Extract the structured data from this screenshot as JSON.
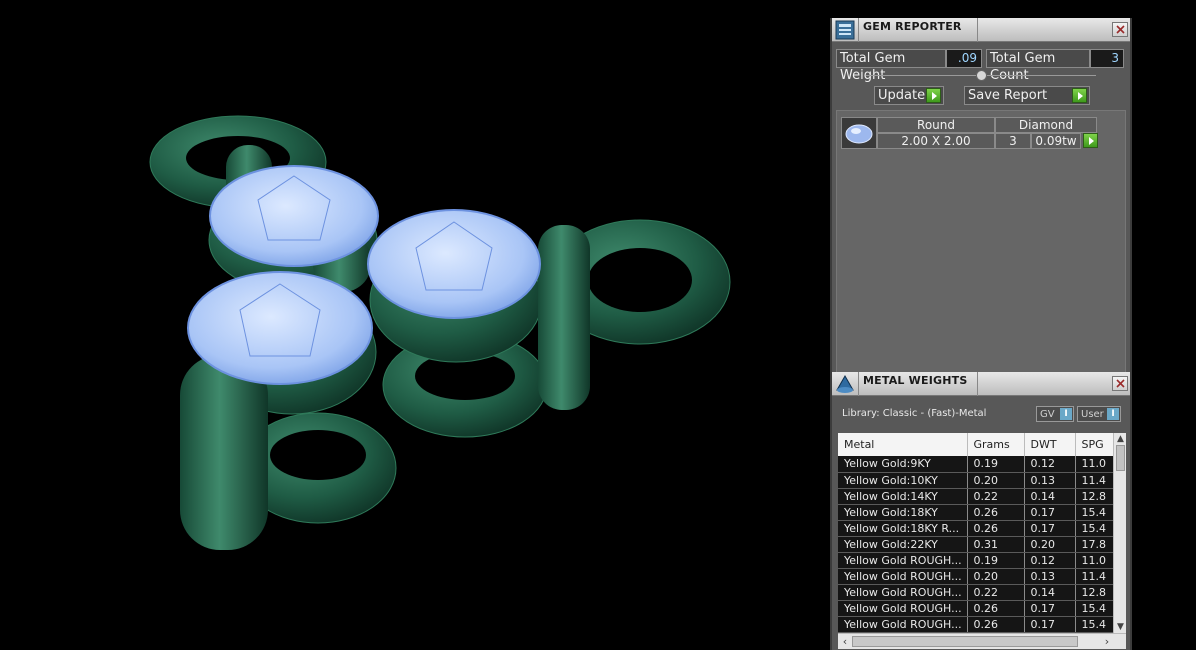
{
  "gem_reporter": {
    "title": "GEM REPORTER",
    "total_weight_label": "Total Gem Weight",
    "total_weight_value": ".09",
    "total_count_label": "Total Gem Count",
    "total_count_value": "3",
    "update_label": "Update",
    "save_report_label": "Save Report",
    "gems": [
      {
        "shape": "Round",
        "material": "Diamond",
        "size": "2.00 X 2.00",
        "count": "3",
        "weight": "0.09tw"
      }
    ]
  },
  "metal_weights": {
    "title": "METAL WEIGHTS",
    "library": "Library: Classic - (Fast)-Metal",
    "gv_label": "GV",
    "gv_toggle": "I",
    "user_label": "User",
    "user_toggle": "I",
    "columns": [
      "Metal",
      "Grams",
      "DWT",
      "SPG"
    ],
    "rows": [
      [
        "Yellow Gold:9KY",
        "0.19",
        "0.12",
        "11.0"
      ],
      [
        "Yellow Gold:10KY",
        "0.20",
        "0.13",
        "11.4"
      ],
      [
        "Yellow Gold:14KY",
        "0.22",
        "0.14",
        "12.8"
      ],
      [
        "Yellow Gold:18KY",
        "0.26",
        "0.17",
        "15.4"
      ],
      [
        "Yellow Gold:18KY R...",
        "0.26",
        "0.17",
        "15.4"
      ],
      [
        "Yellow Gold:22KY",
        "0.31",
        "0.20",
        "17.8"
      ],
      [
        "Yellow Gold ROUGH...",
        "0.19",
        "0.12",
        "11.0"
      ],
      [
        "Yellow Gold ROUGH...",
        "0.20",
        "0.13",
        "11.4"
      ],
      [
        "Yellow Gold ROUGH...",
        "0.22",
        "0.14",
        "12.8"
      ],
      [
        "Yellow Gold ROUGH...",
        "0.26",
        "0.17",
        "15.4"
      ],
      [
        "Yellow Gold ROUGH...",
        "0.26",
        "0.17",
        "15.4"
      ]
    ]
  },
  "colors": {
    "metal": "#1e5a44",
    "gem": "#a8c8ff",
    "panel": "#585858"
  }
}
